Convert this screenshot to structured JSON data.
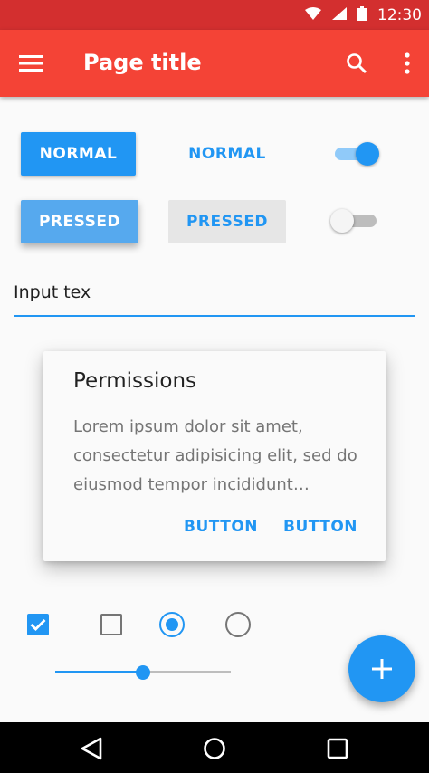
{
  "status_bar": {
    "time": "12:30",
    "icons": [
      "wifi-icon",
      "signal-icon",
      "battery-icon"
    ]
  },
  "app_bar": {
    "title": "Page title",
    "icons": [
      "menu-icon",
      "search-icon",
      "more-vert-icon"
    ]
  },
  "buttons": {
    "raised_normal": "NORMAL",
    "flat_normal": "NORMAL",
    "raised_pressed": "PRESSED",
    "flat_pressed": "PRESSED"
  },
  "switches": {
    "switch_1_on": true,
    "switch_2_on": false
  },
  "input": {
    "value": "Input tex"
  },
  "dialog": {
    "title": "Permissions",
    "body": "Lorem ipsum dolor sit amet, consectetur adipisicing elit, sed do eiusmod tempor incididunt…",
    "button_1": "BUTTON",
    "button_2": "BUTTON"
  },
  "controls": {
    "checkbox_1_checked": true,
    "checkbox_2_checked": false,
    "radio_1_selected": true,
    "radio_2_selected": false,
    "slider_value_fraction": 0.5
  },
  "fab": {
    "icon": "add-icon"
  },
  "nav_bar": {
    "icons": [
      "back-icon",
      "home-icon",
      "recents-icon"
    ]
  },
  "colors": {
    "status_bar": "#d32f2f",
    "app_bar": "#f44336",
    "accent": "#2196f3",
    "text_primary": "#212121",
    "text_secondary": "#757575"
  }
}
